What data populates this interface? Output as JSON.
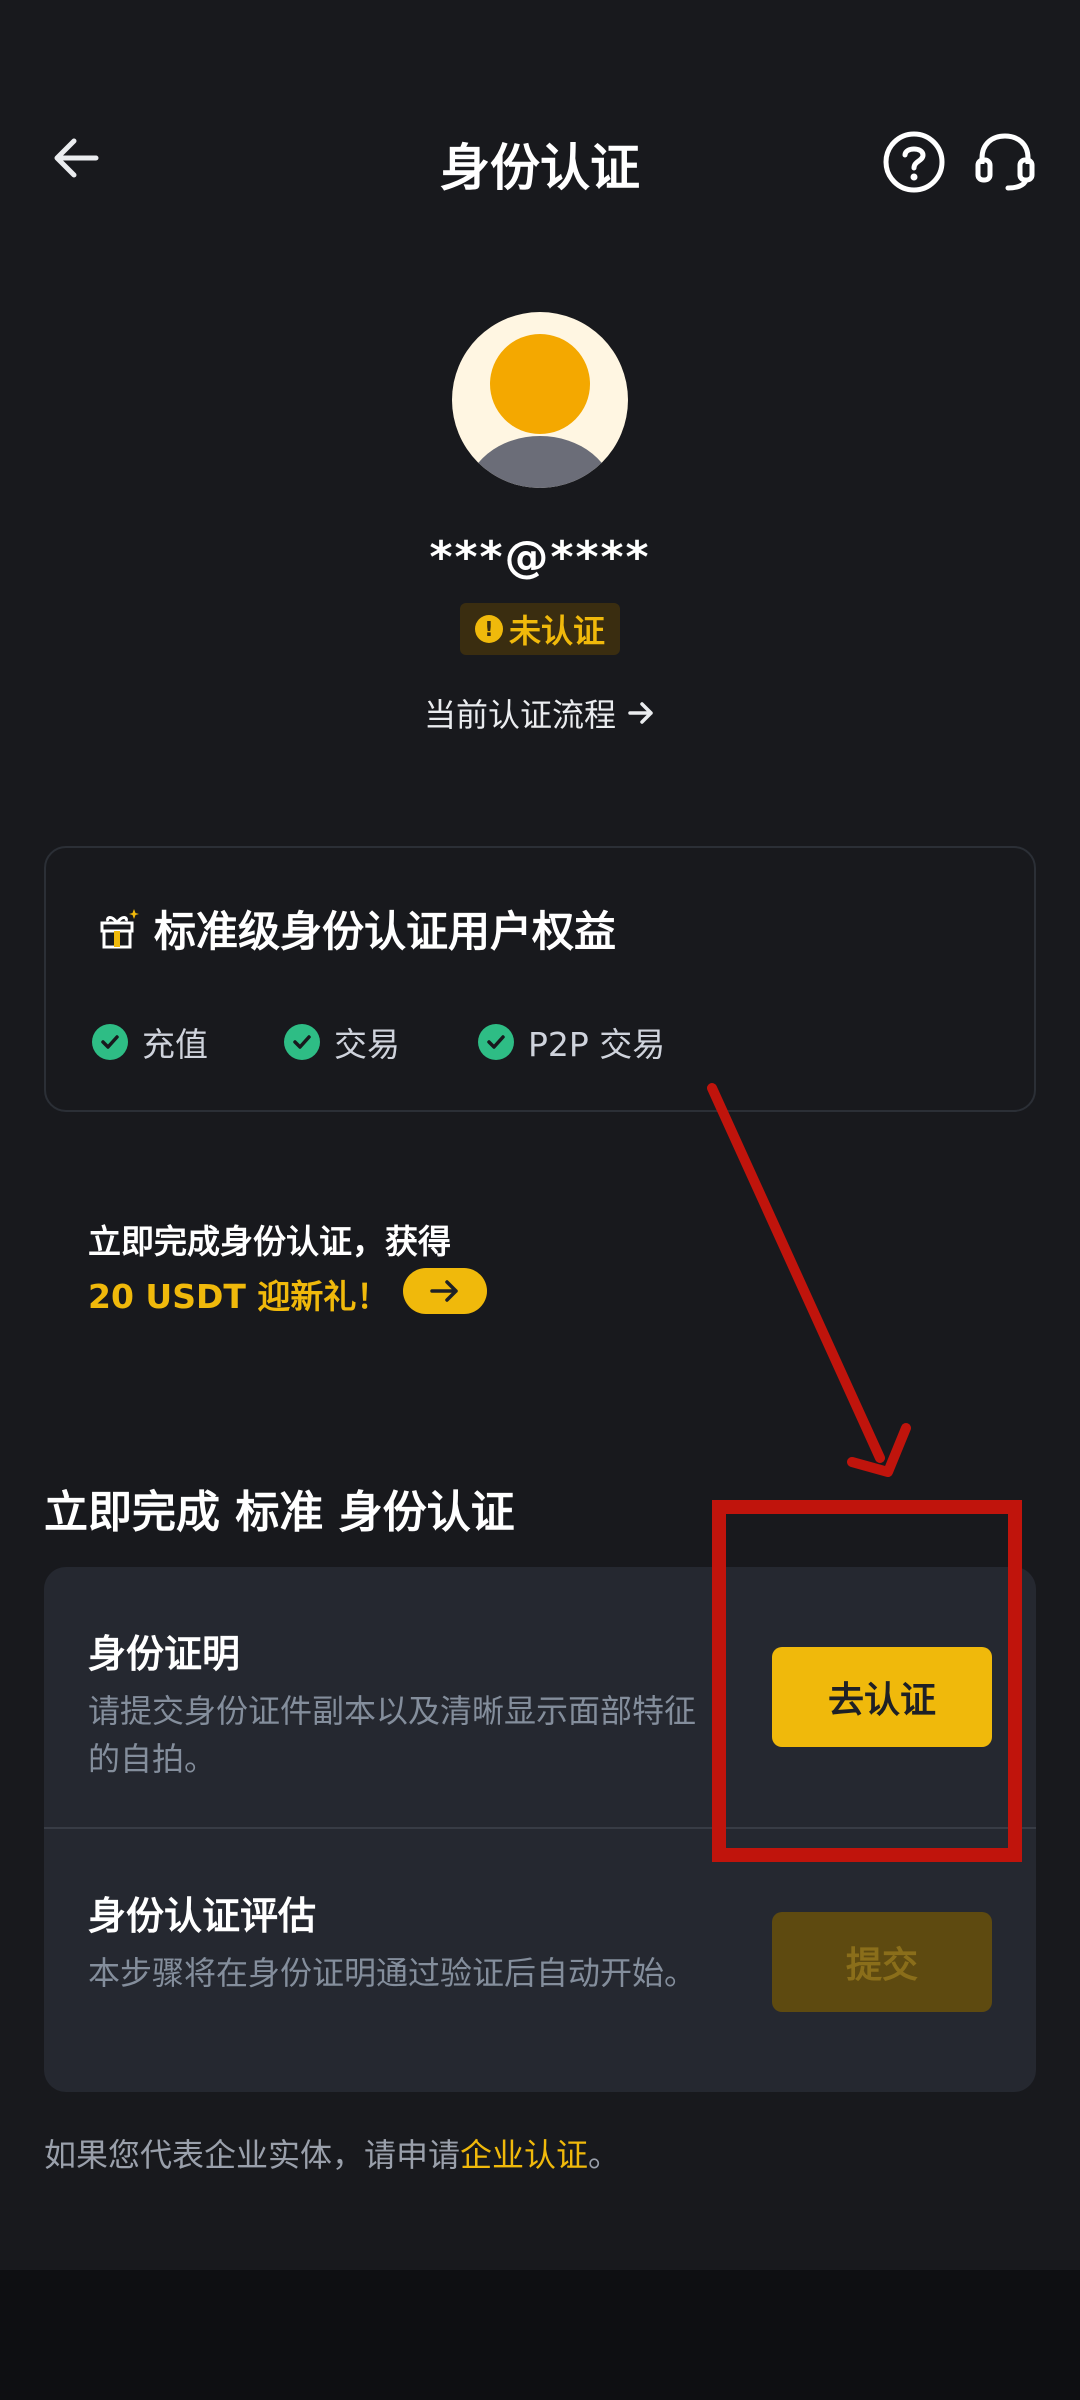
{
  "header": {
    "title": "身份认证"
  },
  "profile": {
    "account": "***@****",
    "status": "未认证",
    "flow_link": "当前认证流程"
  },
  "benefits": {
    "title": "标准级身份认证用户权益",
    "items": [
      "充值",
      "交易",
      "P2P 交易"
    ]
  },
  "promo": {
    "line1": "立即完成身份认证，获得",
    "line2": "20 USDT 迎新礼！"
  },
  "section": {
    "title": "立即完成 标准 身份认证"
  },
  "steps": [
    {
      "title": "身份证明",
      "desc": "请提交身份证件副本以及清晰显示面部特征的自拍。",
      "button": "去认证"
    },
    {
      "title": "身份认证评估",
      "desc": "本步骤将在身份证明通过验证后自动开始。",
      "button": "提交"
    }
  ],
  "footer": {
    "prefix": "如果您代表企业实体，请申请",
    "link": "企业认证",
    "suffix": "。"
  },
  "colors": {
    "accent": "#f0b90b",
    "success": "#2ebd85",
    "annotation": "#c0140c"
  }
}
